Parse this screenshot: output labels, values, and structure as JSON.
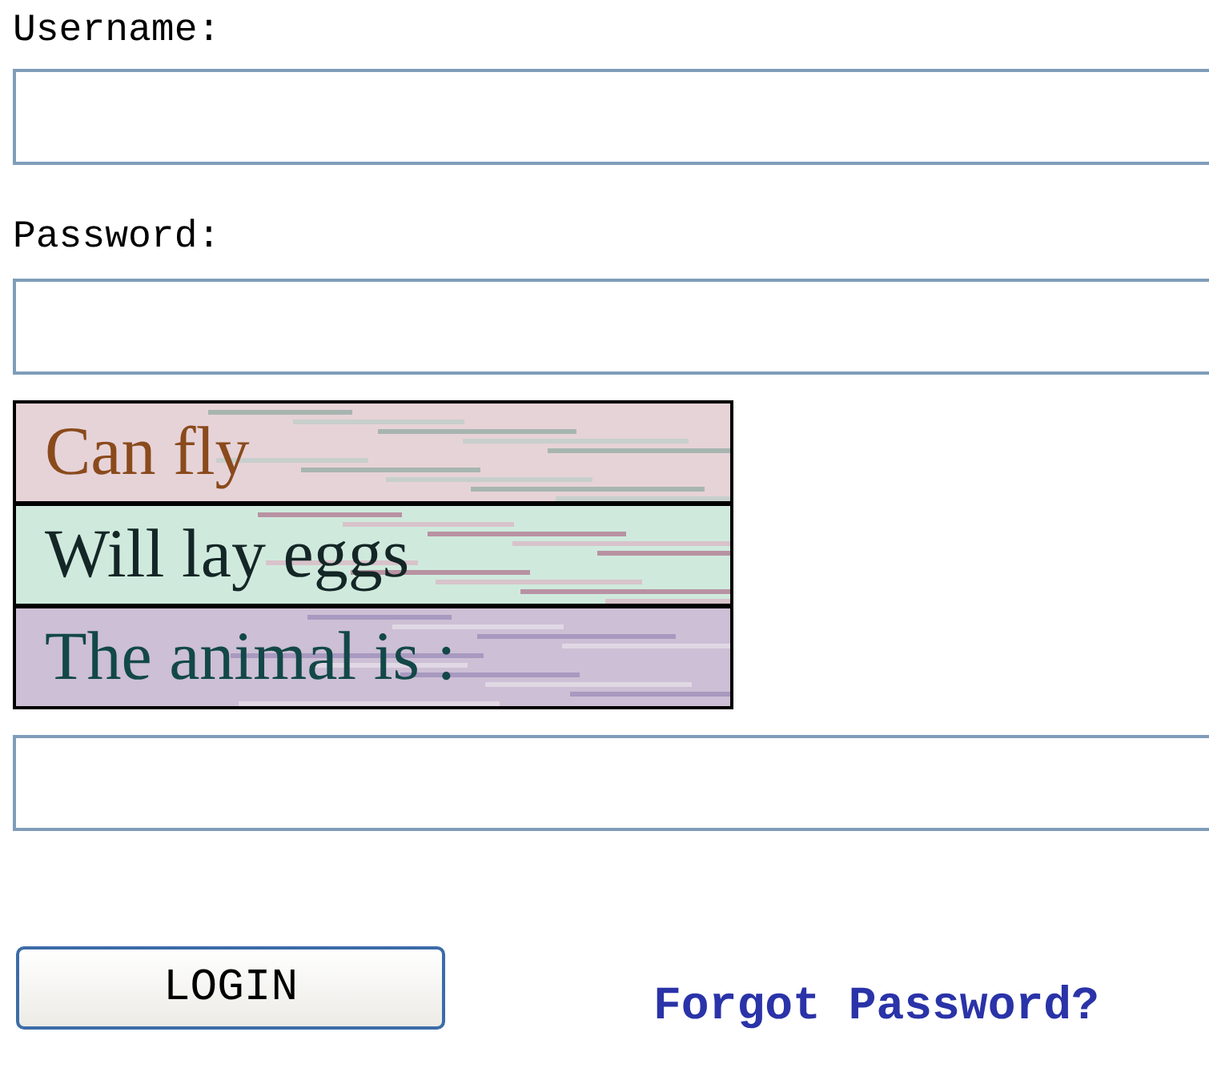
{
  "username": {
    "label": "Username:"
  },
  "password": {
    "label": "Password:"
  },
  "captcha": {
    "lines": [
      {
        "text": "Can fly",
        "color": "#8a4a1c"
      },
      {
        "text": "Will lay eggs",
        "color": "#142626"
      },
      {
        "text": "The animal is :",
        "color": "#124848"
      }
    ]
  },
  "login_button": {
    "label": "LOGIN"
  },
  "forgot_link": {
    "label": "Forgot Password?"
  }
}
